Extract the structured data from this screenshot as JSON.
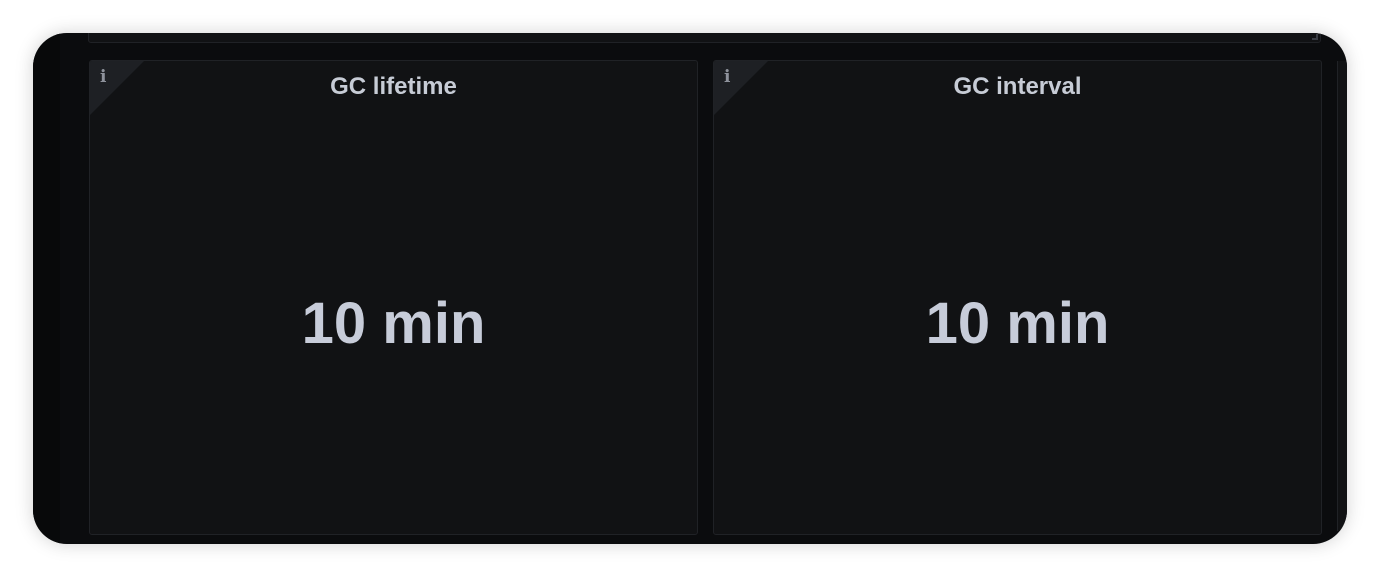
{
  "panels": [
    {
      "title": "GC lifetime",
      "value": "10 min",
      "info_icon": "i"
    },
    {
      "title": "GC interval",
      "value": "10 min",
      "info_icon": "i"
    }
  ],
  "colors": {
    "background": "#0b0c0e",
    "panel": "#111214",
    "panel_border": "#202226",
    "text": "#c7ccd6",
    "info_icon": "#8e929b"
  },
  "icons": [
    "info-icon",
    "resize-handle-icon"
  ]
}
